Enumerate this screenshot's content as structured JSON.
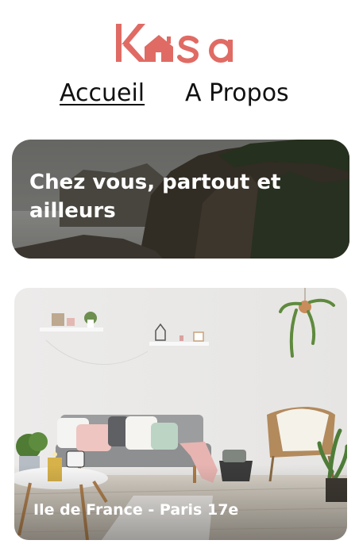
{
  "brand": {
    "logo_text": "Kasa",
    "accent_color": "#E06B64"
  },
  "nav": {
    "home_label": "Accueil",
    "about_label": "A Propos"
  },
  "banner": {
    "title": "Chez vous, partout et ailleurs"
  },
  "listings": [
    {
      "title": "Ile de France - Paris 17e"
    }
  ]
}
